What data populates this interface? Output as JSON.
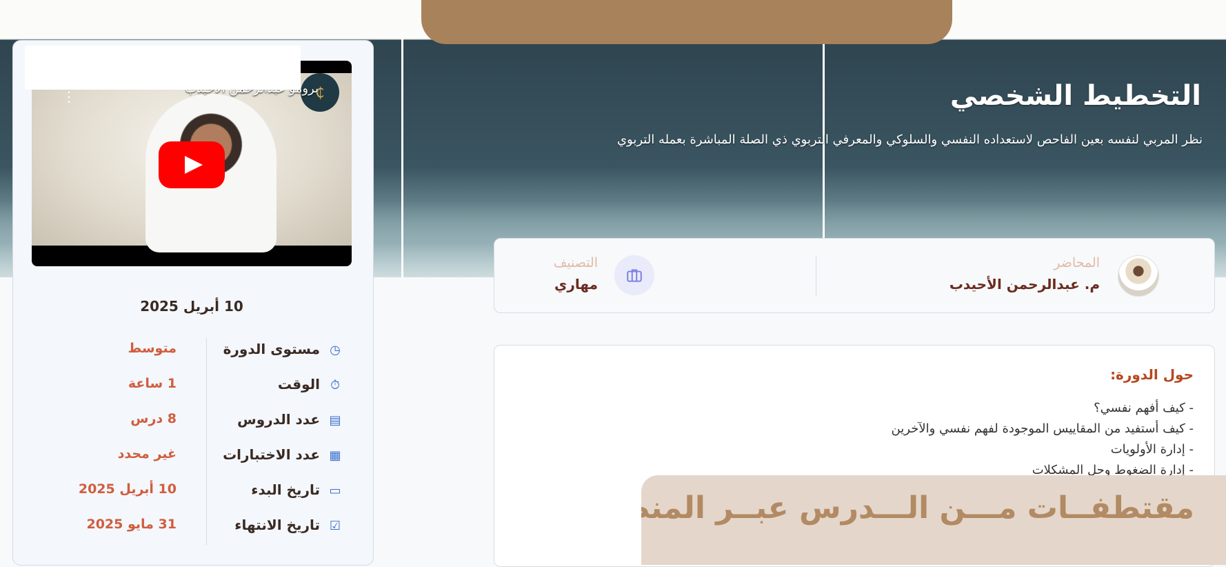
{
  "banner": {
    "title": "التخطيط الشخصي",
    "subtitle": "نظر المربي لنفسه بعين الفاحص لاستعداده النفسي والسلوكي والمعرفي التربوي ذي الصلة المباشرة بعمله التربوي",
    "top_pill_text": ".."
  },
  "info": {
    "lecturer_label": "المحاضر",
    "lecturer_name": "م. عبدالرحمن الأحيدب",
    "category_label": "التصنيف",
    "category_value": "مهاري"
  },
  "about": {
    "title": "حول الدورة:",
    "items": [
      "كيف أفهم نفسي؟",
      "كيف أستفيد من المقاييس الموجودة لفهم نفسي والآخرين",
      "إدارة الأولويات",
      "إدارة الضغوط وحل المشكلات"
    ]
  },
  "clips_banner": "مقتطفــات مـــن الـــدرس عبــر المنصـــة",
  "video": {
    "title": "برومو عبدالرحمن الأحيدب",
    "channel_icon": "₵",
    "menu_icon": "⋮"
  },
  "sidebar": {
    "date": "10 أبريل 2025",
    "rows": [
      {
        "label": "مستوى الدورة",
        "value": "متوسط",
        "icon": "◷"
      },
      {
        "label": "الوقت",
        "value": "1 ساعة",
        "icon": "⏱"
      },
      {
        "label": "عدد الدروس",
        "value": "8 درس",
        "icon": "▤"
      },
      {
        "label": "عدد الاختبارات",
        "value": "غير محدد",
        "icon": "▦"
      },
      {
        "label": "تاريخ البدء",
        "value": "10 أبريل 2025",
        "icon": "▭"
      },
      {
        "label": "تاريخ الانتهاء",
        "value": "31 مايو 2025",
        "icon": "☑"
      }
    ]
  },
  "colors": {
    "accent": "#b5481f",
    "label": "#e2b9a6",
    "value": "#d05d3d",
    "banner_pill": "#a8825a"
  }
}
